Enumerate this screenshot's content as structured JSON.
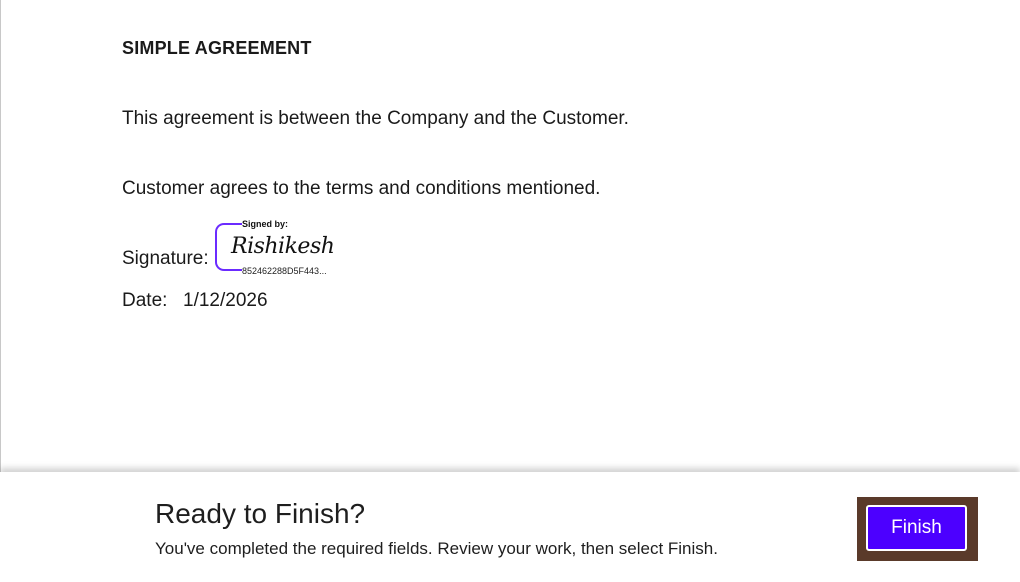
{
  "document": {
    "title": "SIMPLE AGREEMENT",
    "paragraph1": "This agreement is between the Company and the Customer.",
    "paragraph2": "Customer agrees to the terms and conditions mentioned.",
    "signature_label": "Signature:",
    "signature": {
      "signed_by_label": "Signed by:",
      "name": "Rishikesh",
      "id": "852462288D5F443..."
    },
    "date_label": "Date:",
    "date_value": "1/12/2026"
  },
  "footer": {
    "title": "Ready to Finish?",
    "subtitle": "You've completed the required fields. Review your work, then select Finish.",
    "finish_label": "Finish"
  },
  "colors": {
    "accent": "#4c00ff",
    "signature_border": "#6b2bff",
    "focus_ring": "#5a3a2a"
  }
}
